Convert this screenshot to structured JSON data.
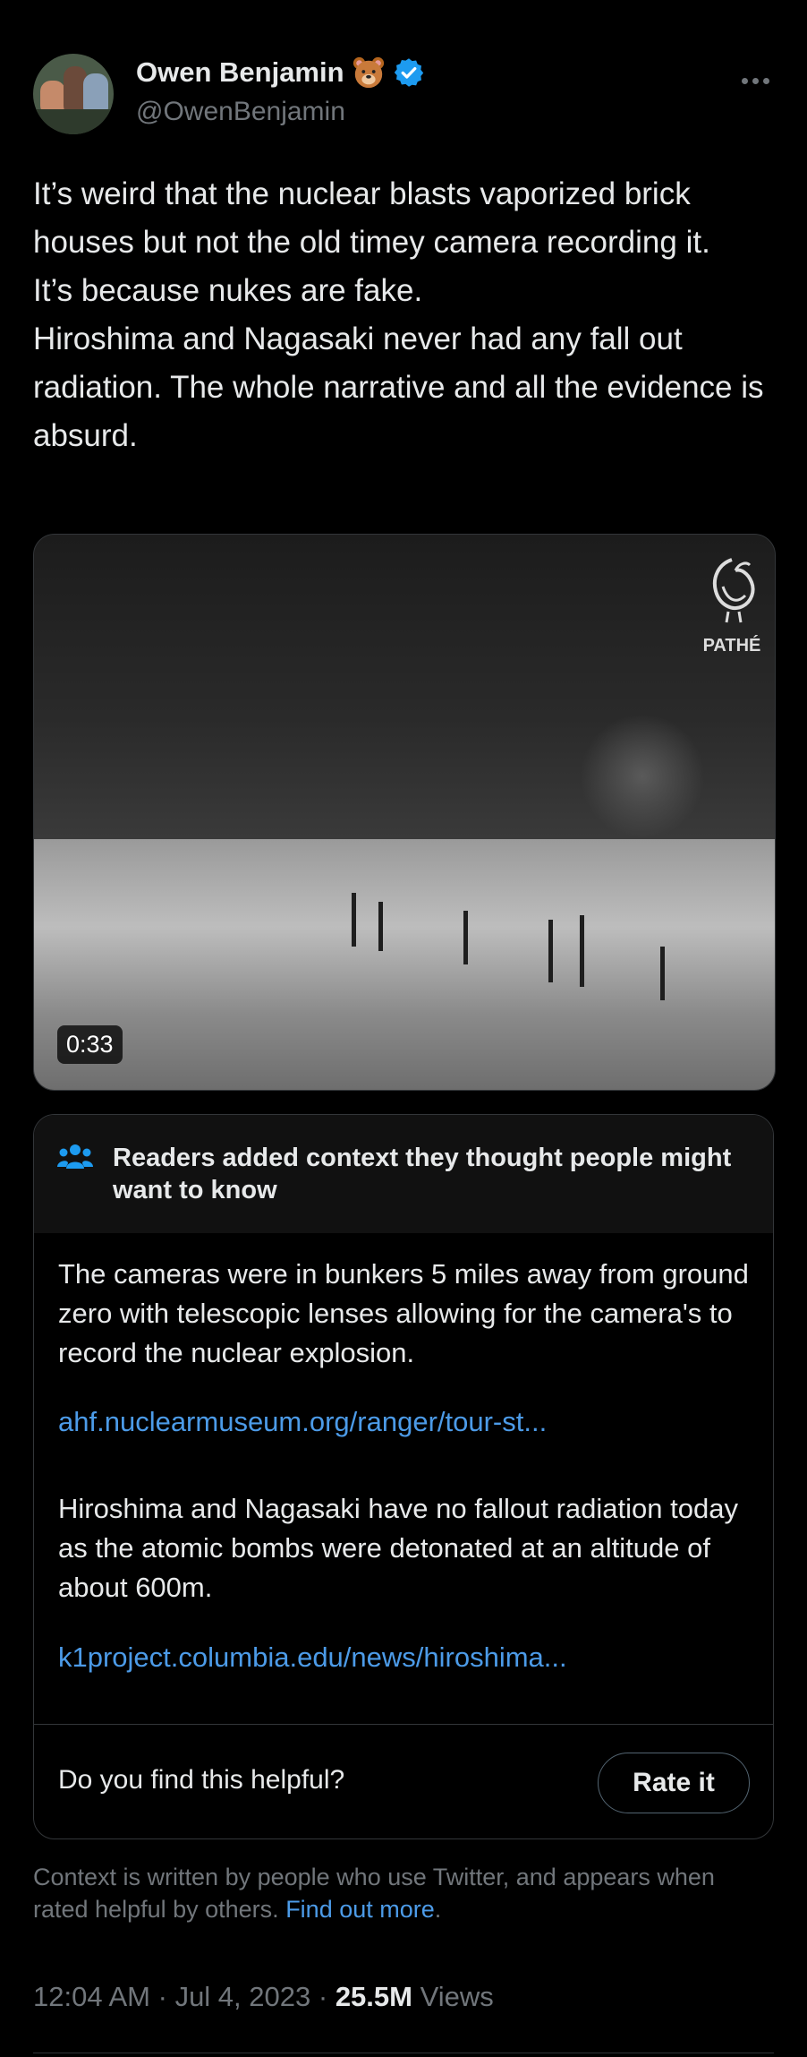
{
  "author": {
    "name": "Owen Benjamin",
    "handle": "@OwenBenjamin",
    "verified": true,
    "name_emoji": "bear-face"
  },
  "tweet": {
    "paragraphs": [
      "It’s weird that the nuclear blasts vaporized brick houses but not the old timey camera recording it.",
      "It’s because nukes are fake.",
      "Hiroshima and Nagasaki never had any fall out radiation. The whole narrative and all the evidence is absurd."
    ]
  },
  "video": {
    "duration": "0:33",
    "watermark": "PATHÉ"
  },
  "community_note": {
    "title": "Readers added context they thought people might want to know",
    "paragraph1": "The cameras were in bunkers 5 miles away from ground zero with telescopic lenses allowing for the camera's to record the nuclear explosion.",
    "link1": "ahf.nuclearmuseum.org/ranger/tour-st...",
    "paragraph2": "Hiroshima and Nagasaki have no fallout radiation today as the atomic bombs were detonated at an altitude of about 600m.",
    "link2": "k1project.columbia.edu/news/hiroshima...",
    "helpful_prompt": "Do you find this helpful?",
    "rate_label": "Rate it"
  },
  "footnote": {
    "text": "Context is written by people who use Twitter, and appears when rated helpful by others.",
    "link": "Find out more",
    "period": "."
  },
  "meta": {
    "time": "12:04 AM",
    "date": "Jul 4, 2023",
    "sep": "·",
    "views_count": "25.5M",
    "views_label": "Views"
  },
  "colors": {
    "background": "#000000",
    "text": "#e7e9ea",
    "secondary": "#71767b",
    "link": "#4c9be8",
    "verified": "#1d9bf0"
  }
}
